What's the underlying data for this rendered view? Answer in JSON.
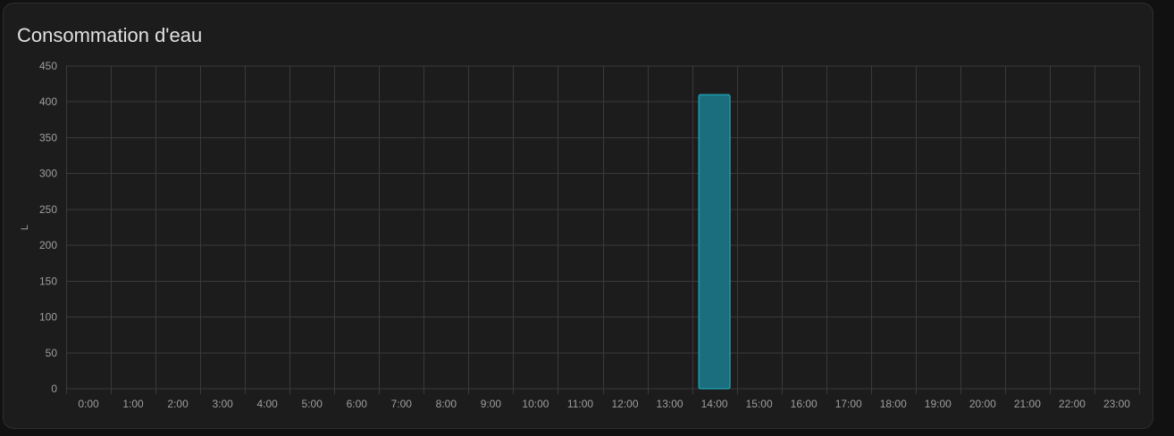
{
  "card": {
    "title": "Consommation d'eau"
  },
  "colors": {
    "card_background": "#1c1c1c",
    "grid": "#3a3a3a",
    "bar_fill": "#1a6e7e",
    "bar_stroke": "#22b8cf",
    "text": "#9e9e9e",
    "title": "#e1e1e1"
  },
  "chart_data": {
    "type": "bar",
    "title": "Consommation d'eau",
    "xlabel": "",
    "ylabel": "L",
    "ylim": [
      0,
      450
    ],
    "yticks": [
      0,
      50,
      100,
      150,
      200,
      250,
      300,
      350,
      400,
      450
    ],
    "grid": true,
    "categories": [
      "0:00",
      "1:00",
      "2:00",
      "3:00",
      "4:00",
      "5:00",
      "6:00",
      "7:00",
      "8:00",
      "9:00",
      "10:00",
      "11:00",
      "12:00",
      "13:00",
      "14:00",
      "15:00",
      "16:00",
      "17:00",
      "18:00",
      "19:00",
      "20:00",
      "21:00",
      "22:00",
      "23:00"
    ],
    "series": [
      {
        "values": [
          0,
          0,
          0,
          0,
          0,
          0,
          0,
          0,
          0,
          0,
          0,
          0,
          0,
          0,
          410,
          0,
          0,
          0,
          0,
          0,
          0,
          0,
          0,
          0
        ]
      }
    ]
  }
}
